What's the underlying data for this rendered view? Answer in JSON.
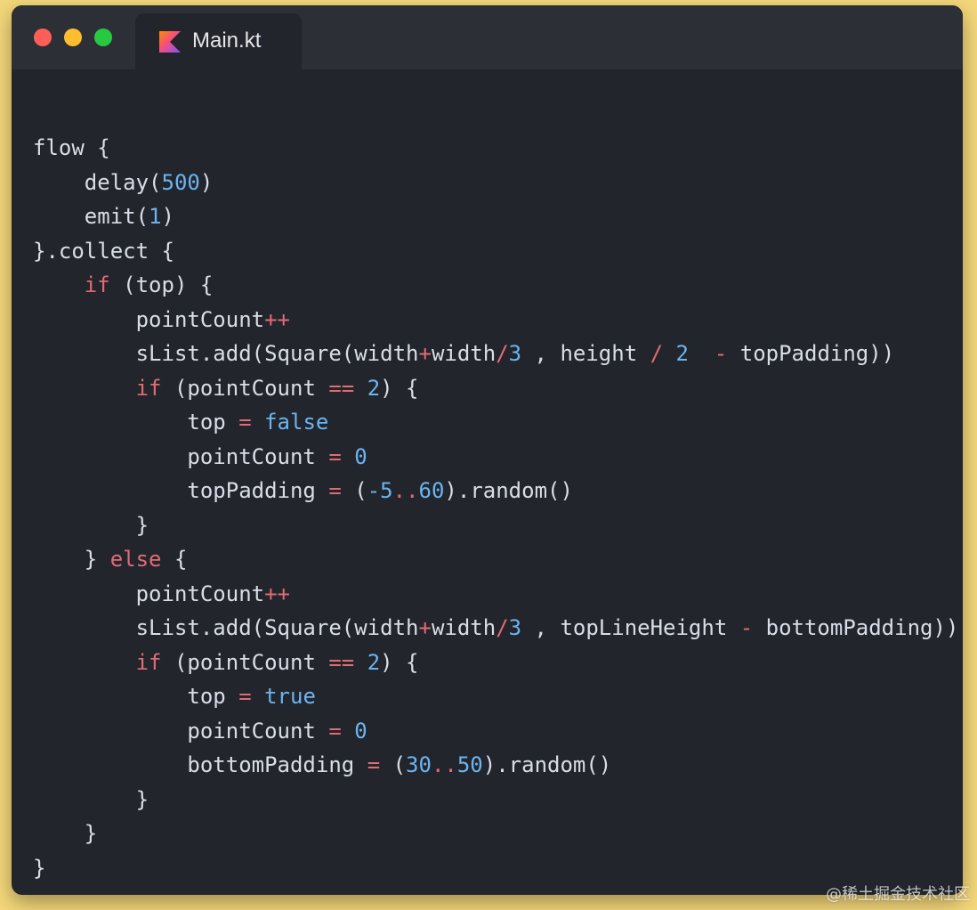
{
  "window": {
    "tab_title": "Main.kt",
    "tab_icon": "kotlin-icon",
    "buttons": [
      "close-icon",
      "minimize-icon",
      "zoom-icon"
    ]
  },
  "code": {
    "lines": [
      [
        {
          "t": "flow {",
          "c": "ident"
        }
      ],
      [
        {
          "t": "    delay(",
          "c": "ident"
        },
        {
          "t": "500",
          "c": "num"
        },
        {
          "t": ")",
          "c": "ident"
        }
      ],
      [
        {
          "t": "    emit(",
          "c": "ident"
        },
        {
          "t": "1",
          "c": "num"
        },
        {
          "t": ")",
          "c": "ident"
        }
      ],
      [
        {
          "t": "}.collect {",
          "c": "ident"
        }
      ],
      [
        {
          "t": "    ",
          "c": "ident"
        },
        {
          "t": "if",
          "c": "kw"
        },
        {
          "t": " (top) {",
          "c": "ident"
        }
      ],
      [
        {
          "t": "        pointCount",
          "c": "ident"
        },
        {
          "t": "++",
          "c": "op"
        }
      ],
      [
        {
          "t": "        sList.add(Square(width",
          "c": "ident"
        },
        {
          "t": "+",
          "c": "op"
        },
        {
          "t": "width",
          "c": "ident"
        },
        {
          "t": "/",
          "c": "op"
        },
        {
          "t": "3",
          "c": "num"
        },
        {
          "t": " , height ",
          "c": "ident"
        },
        {
          "t": "/",
          "c": "op"
        },
        {
          "t": " ",
          "c": "ident"
        },
        {
          "t": "2",
          "c": "num"
        },
        {
          "t": "  ",
          "c": "ident"
        },
        {
          "t": "-",
          "c": "op"
        },
        {
          "t": " topPadding))",
          "c": "ident"
        }
      ],
      [
        {
          "t": "        ",
          "c": "ident"
        },
        {
          "t": "if",
          "c": "kw"
        },
        {
          "t": " (pointCount ",
          "c": "ident"
        },
        {
          "t": "==",
          "c": "op"
        },
        {
          "t": " ",
          "c": "ident"
        },
        {
          "t": "2",
          "c": "num"
        },
        {
          "t": ") {",
          "c": "ident"
        }
      ],
      [
        {
          "t": "            top ",
          "c": "ident"
        },
        {
          "t": "=",
          "c": "op"
        },
        {
          "t": " ",
          "c": "ident"
        },
        {
          "t": "false",
          "c": "lit"
        }
      ],
      [
        {
          "t": "            pointCount ",
          "c": "ident"
        },
        {
          "t": "=",
          "c": "op"
        },
        {
          "t": " ",
          "c": "ident"
        },
        {
          "t": "0",
          "c": "num"
        }
      ],
      [
        {
          "t": "            topPadding ",
          "c": "ident"
        },
        {
          "t": "=",
          "c": "op"
        },
        {
          "t": " (",
          "c": "ident"
        },
        {
          "t": "-5",
          "c": "num"
        },
        {
          "t": "..",
          "c": "op"
        },
        {
          "t": "60",
          "c": "num"
        },
        {
          "t": ").random()",
          "c": "ident"
        }
      ],
      [
        {
          "t": "        }",
          "c": "ident"
        }
      ],
      [
        {
          "t": "    } ",
          "c": "ident"
        },
        {
          "t": "else",
          "c": "kw"
        },
        {
          "t": " {",
          "c": "ident"
        }
      ],
      [
        {
          "t": "        pointCount",
          "c": "ident"
        },
        {
          "t": "++",
          "c": "op"
        }
      ],
      [
        {
          "t": "        sList.add(Square(width",
          "c": "ident"
        },
        {
          "t": "+",
          "c": "op"
        },
        {
          "t": "width",
          "c": "ident"
        },
        {
          "t": "/",
          "c": "op"
        },
        {
          "t": "3",
          "c": "num"
        },
        {
          "t": " , topLineHeight ",
          "c": "ident"
        },
        {
          "t": "-",
          "c": "op"
        },
        {
          "t": " bottomPadding))",
          "c": "ident"
        }
      ],
      [
        {
          "t": "        ",
          "c": "ident"
        },
        {
          "t": "if",
          "c": "kw"
        },
        {
          "t": " (pointCount ",
          "c": "ident"
        },
        {
          "t": "==",
          "c": "op"
        },
        {
          "t": " ",
          "c": "ident"
        },
        {
          "t": "2",
          "c": "num"
        },
        {
          "t": ") {",
          "c": "ident"
        }
      ],
      [
        {
          "t": "            top ",
          "c": "ident"
        },
        {
          "t": "=",
          "c": "op"
        },
        {
          "t": " ",
          "c": "ident"
        },
        {
          "t": "true",
          "c": "lit"
        }
      ],
      [
        {
          "t": "            pointCount ",
          "c": "ident"
        },
        {
          "t": "=",
          "c": "op"
        },
        {
          "t": " ",
          "c": "ident"
        },
        {
          "t": "0",
          "c": "num"
        }
      ],
      [
        {
          "t": "            bottomPadding ",
          "c": "ident"
        },
        {
          "t": "=",
          "c": "op"
        },
        {
          "t": " (",
          "c": "ident"
        },
        {
          "t": "30",
          "c": "num"
        },
        {
          "t": "..",
          "c": "op"
        },
        {
          "t": "50",
          "c": "num"
        },
        {
          "t": ").random()",
          "c": "ident"
        }
      ],
      [
        {
          "t": "        }",
          "c": "ident"
        }
      ],
      [
        {
          "t": "    }",
          "c": "ident"
        }
      ],
      [
        {
          "t": "}",
          "c": "ident"
        }
      ]
    ]
  },
  "watermark": "@稀土掘金技术社区",
  "colors": {
    "background": "#f3d77a",
    "window": "#22252b",
    "titlebar": "#2c2f35",
    "keyword": "#e06c75",
    "number": "#6cb4f0",
    "text": "#d8dee9"
  }
}
